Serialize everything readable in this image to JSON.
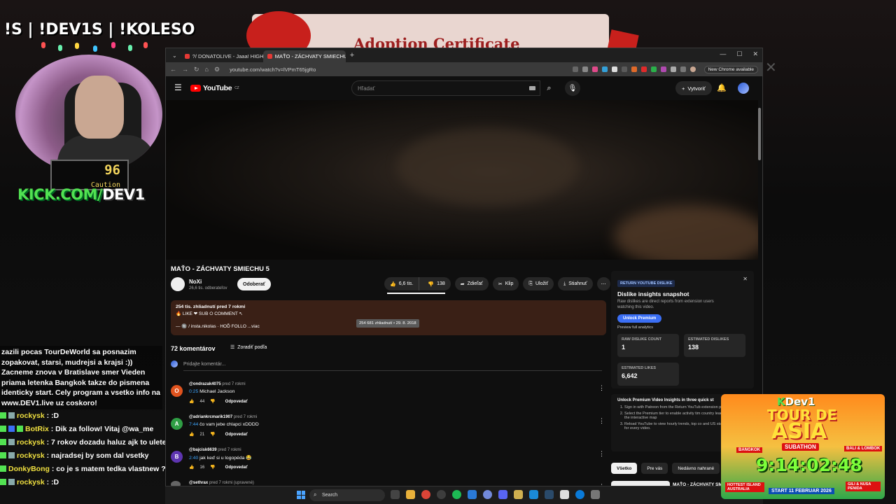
{
  "overlay": {
    "title": "!S | !DEV1S | !KOLESO",
    "meter_value": "96",
    "meter_label": "Caution",
    "kick_green": "KICK.COM/",
    "kick_white": "DEV1",
    "chat_intro": "zazili pocas TourDeWorld sa posnazim zopakovat, starsi, mudrejsi a krajsi :)) Zacneme znova v Bratislave smer Vieden priama letenka Bangkok takze do pismena identicky start. Cely program a vsetko info na www.DEV1.live uz coskoro!",
    "chat": [
      {
        "user": "rockysk",
        "msg": " : :D"
      },
      {
        "user": "BotRix",
        "msg": " : Dik za follow! Vitaj @wa_me"
      },
      {
        "user": "rockysk",
        "msg": " : 7 rokov dozadu haluz ajk to uletelo :D"
      },
      {
        "user": "rockysk",
        "msg": " : najradsej by som dal vsetky"
      },
      {
        "user": "DonkyBong",
        "msg": " : co je s matem tedka vlastnew ?"
      },
      {
        "user": "rockysk",
        "msg": " : :D"
      }
    ],
    "cert_text": "Adoption Certificate"
  },
  "browser": {
    "tabs": [
      {
        "label": "?/ DONATOLIVE - Jaaa! HIGHL",
        "active": false
      },
      {
        "label": "MAŤO - ZÁCHVATY SMIECHU 5",
        "active": true
      }
    ],
    "url": "youtube.com/watch?v=lVPmT65jgRo",
    "new_chrome": "New Chrome available"
  },
  "youtube": {
    "logo": "YouTube",
    "logo_region": "CZ",
    "search_placeholder": "Hľadať",
    "create_label": "Vytvoriť",
    "video_title": "MAŤO - ZÁCHVATY SMIECHU 5",
    "channel_name": "NoXi",
    "channel_subs": "26,6 tis. odberateľov",
    "subscribe_label": "Odoberať",
    "likes": "6,6 tis.",
    "dislikes": "138",
    "share": "Zdieľať",
    "clip": "Klip",
    "save": "Uložiť",
    "download": "Stiahnuť",
    "desc_meta": "254 tis. zhliadnutí  pred 7 rokmi",
    "desc_line1": "🔥 LIKE ❤ SUB ⭘ COMMENT ↖",
    "desc_line2": "— 🔘 / insta.nikolas   · HOĎ FOLLO  ...viac",
    "tooltip": "254 681 zhliadnutí • 29. 8. 2018",
    "comments_count": "72 komentárov",
    "sort_label": "Zoradiť podľa",
    "add_comment": "Pridajte komentár...",
    "reply_label": "Odpovedať",
    "comments": [
      {
        "initial": "O",
        "color": "#e0531e",
        "user": "@ondrazak4075",
        "ago": "pred 7 rokmi",
        "ts": "0:25",
        "text": " Michael Jackson",
        "likes": "44"
      },
      {
        "initial": "A",
        "color": "#2f9e44",
        "user": "@adriankrcmarik1907",
        "ago": "pred 7 rokmi",
        "ts": "7:44",
        "text": " čo vam jebe chlapci xDDDD",
        "likes": "21"
      },
      {
        "initial": "B",
        "color": "#5e35b1",
        "user": "@bajcisk6639",
        "ago": "pred 7 rokmi",
        "ts": "2:40",
        "text": " jak keď si u logopéda 😂",
        "likes": "16"
      },
      {
        "initial": "",
        "color": "#666666",
        "user": "@sethrax",
        "ago": "pred 7 rokmi (upravené)",
        "ts": "",
        "text": "",
        "likes": ""
      }
    ]
  },
  "ryd": {
    "tag": "RETURN YOUTUBE DISLIKE",
    "heading": "Dislike insights snapshot",
    "sub": "Raw dislikes are direct reports from extension users watching this video.",
    "premium": "Unlock Premium",
    "preview": "Preview full analytics",
    "stats": [
      {
        "label": "RAW DISLIKE COUNT",
        "value": "1"
      },
      {
        "label": "ESTIMATED DISLIKES",
        "value": "138"
      },
      {
        "label": "ESTIMATED LIKES",
        "value": "6,642"
      }
    ],
    "insights_heading": "Unlock Premium Video Insights in three quick st",
    "steps": [
      "Sign in with Patreon from the Return YouTub extension popup.",
      "Select the Premium tier to enable activity tim country leaderboards, and the interactive map",
      "Reload YouTube to view hourly trends, top co and US state drill-downs for every video."
    ]
  },
  "chips": [
    "Všetko",
    "Pre vás",
    "Nedávno nahrané",
    "P"
  ],
  "reco_title": "MAŤO - ZÁCHVATY SM",
  "taskbar": {
    "search": "Search"
  },
  "subathon": {
    "kdev_k": "K",
    "kdev": "Dev1",
    "tour": "TOUR DE",
    "asia": "ASIA",
    "sub": "SUBATHON",
    "bkk": "BANGKOK",
    "bali": "BALI & LOMBOK",
    "timer": "9:14:02:48",
    "start": "START 11 FEBRUAR 2026",
    "hot": "HOTTEST ISLAND AUSTRALIA",
    "gili": "GILI & NUSA PENIDA"
  }
}
